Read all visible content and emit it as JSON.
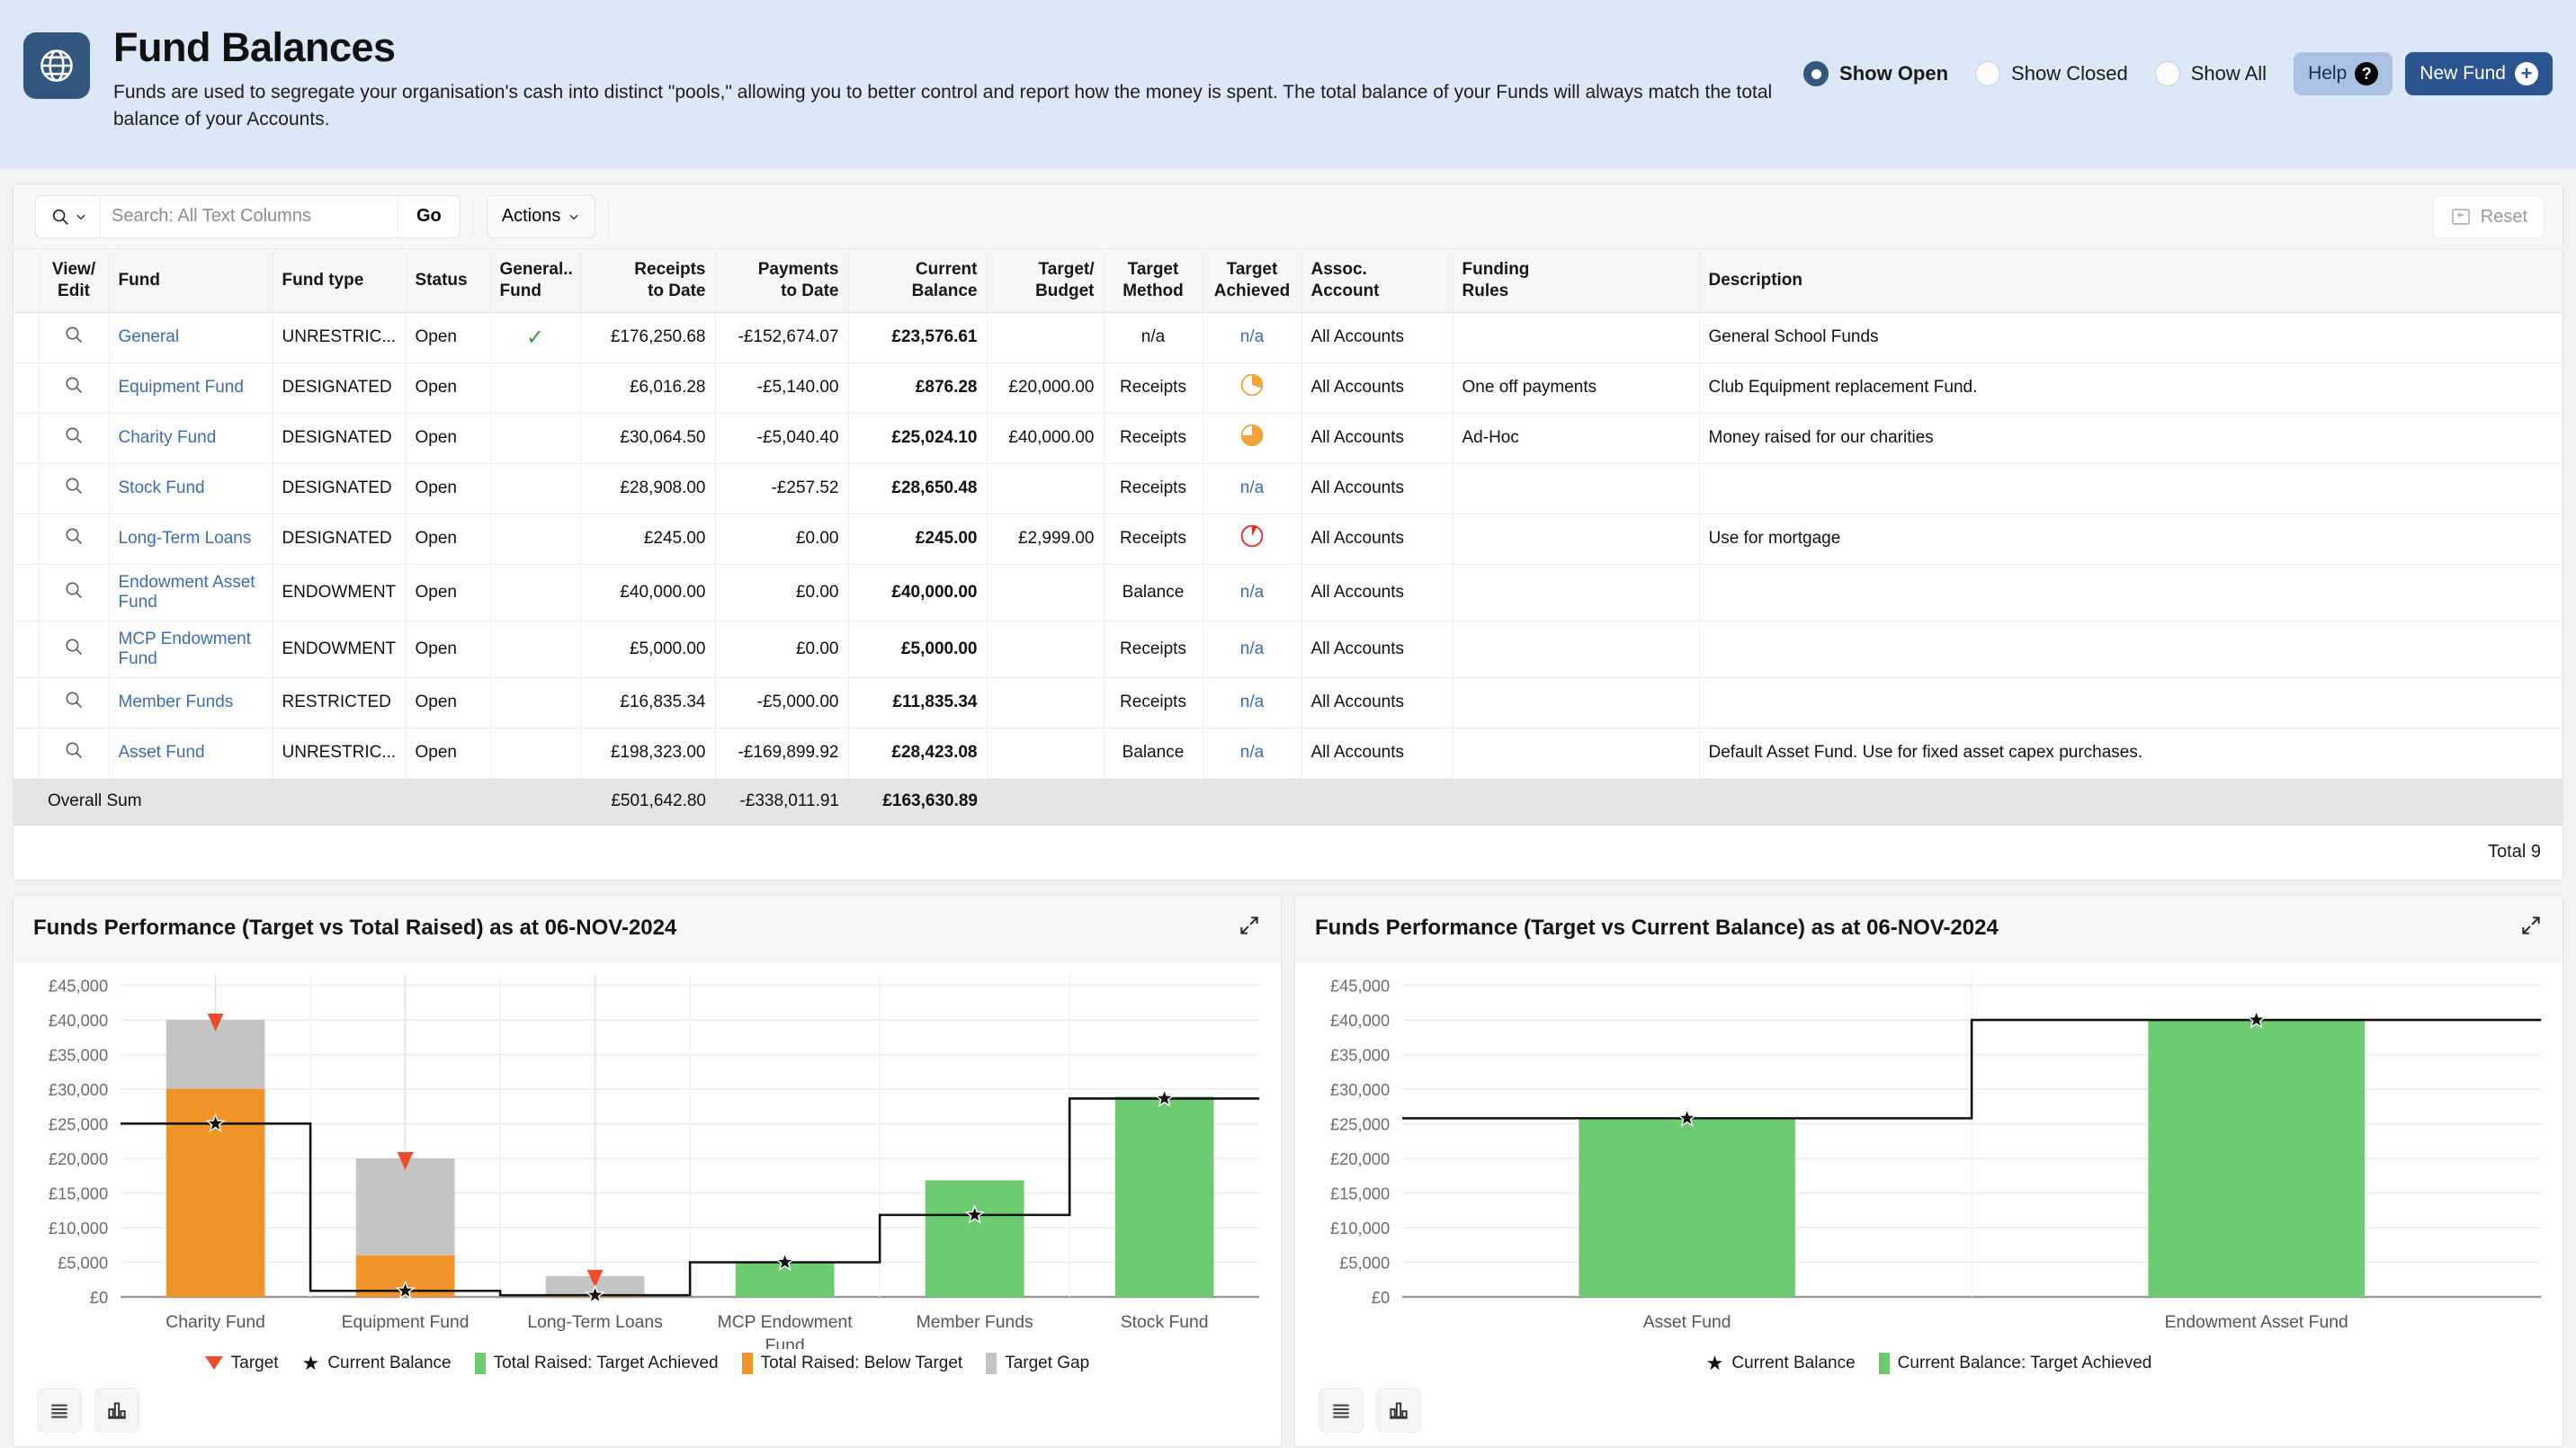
{
  "header": {
    "title": "Fund Balances",
    "description": "Funds are used to segregate your organisation's cash into distinct \"pools,\" allowing you to better control and report how the money is spent. The total balance of your Funds will always match the total balance of your Accounts.",
    "app_icon": "globe-icon",
    "radios": [
      {
        "label": "Show Open",
        "selected": true
      },
      {
        "label": "Show Closed",
        "selected": false
      },
      {
        "label": "Show All",
        "selected": false
      }
    ],
    "help_label": "Help",
    "new_fund_label": "New Fund",
    "accent_color": "#2a5591",
    "header_bg": "#dce7f7"
  },
  "toolbar": {
    "search_placeholder": "Search: All Text Columns",
    "search_value": "",
    "go_label": "Go",
    "actions_label": "Actions",
    "reset_label": "Reset"
  },
  "table": {
    "columns": [
      "View/ Edit",
      "Fund",
      "Fund type",
      "Status",
      "General.. Fund",
      "Receipts to Date",
      "Payments to Date",
      "Current Balance",
      "Target/ Budget",
      "Target Method",
      "Target Achieved",
      "Assoc. Account",
      "Funding Rules",
      "Description"
    ],
    "columns_split": [
      [
        "View/",
        "Edit"
      ],
      [
        "Fund",
        ""
      ],
      [
        "Fund type",
        ""
      ],
      [
        "Status",
        ""
      ],
      [
        "General..",
        "Fund"
      ],
      [
        "Receipts",
        "to Date"
      ],
      [
        "Payments",
        "to Date"
      ],
      [
        "Current",
        "Balance"
      ],
      [
        "Target/",
        "Budget"
      ],
      [
        "Target",
        "Method"
      ],
      [
        "Target",
        "Achieved"
      ],
      [
        "Assoc.",
        "Account"
      ],
      [
        "Funding",
        "Rules"
      ],
      [
        "Description",
        ""
      ]
    ],
    "rows": [
      {
        "fund": "General",
        "fund_type": "UNRESTRIC...",
        "status": "Open",
        "general_fund": true,
        "receipts": "£176,250.68",
        "payments": "-£152,674.07",
        "balance": "£23,576.61",
        "target": "",
        "method": "n/a",
        "achieved": "n/a",
        "achieved_type": "na",
        "account": "All Accounts",
        "rules": "",
        "description": "General School Funds"
      },
      {
        "fund": "Equipment Fund",
        "fund_type": "DESIGNATED",
        "status": "Open",
        "general_fund": false,
        "receipts": "£6,016.28",
        "payments": "-£5,140.00",
        "balance": "£876.28",
        "target": "£20,000.00",
        "method": "Receipts",
        "achieved": "",
        "achieved_type": "pie-orange-30",
        "account": "All Accounts",
        "rules": "One off payments",
        "description": "Club Equipment replacement Fund."
      },
      {
        "fund": "Charity Fund",
        "fund_type": "DESIGNATED",
        "status": "Open",
        "general_fund": false,
        "receipts": "£30,064.50",
        "payments": "-£5,040.40",
        "balance": "£25,024.10",
        "target": "£40,000.00",
        "method": "Receipts",
        "achieved": "",
        "achieved_type": "pie-orange-75",
        "account": "All Accounts",
        "rules": "Ad-Hoc",
        "description": "Money raised for our charities"
      },
      {
        "fund": "Stock Fund",
        "fund_type": "DESIGNATED",
        "status": "Open",
        "general_fund": false,
        "receipts": "£28,908.00",
        "payments": "-£257.52",
        "balance": "£28,650.48",
        "target": "",
        "method": "Receipts",
        "achieved": "n/a",
        "achieved_type": "na",
        "account": "All Accounts",
        "rules": "",
        "description": ""
      },
      {
        "fund": "Long-Term Loans",
        "fund_type": "DESIGNATED",
        "status": "Open",
        "general_fund": false,
        "receipts": "£245.00",
        "payments": "£0.00",
        "balance": "£245.00",
        "target": "£2,999.00",
        "method": "Receipts",
        "achieved": "",
        "achieved_type": "pie-red-8",
        "account": "All Accounts",
        "rules": "",
        "description": "Use for mortgage"
      },
      {
        "fund": "Endowment Asset Fund",
        "fund_type": "ENDOWMENT",
        "status": "Open",
        "general_fund": false,
        "receipts": "£40,000.00",
        "payments": "£0.00",
        "balance": "£40,000.00",
        "target": "",
        "method": "Balance",
        "achieved": "n/a",
        "achieved_type": "na",
        "account": "All Accounts",
        "rules": "",
        "description": ""
      },
      {
        "fund": "MCP Endowment Fund",
        "fund_type": "ENDOWMENT",
        "status": "Open",
        "general_fund": false,
        "receipts": "£5,000.00",
        "payments": "£0.00",
        "balance": "£5,000.00",
        "target": "",
        "method": "Receipts",
        "achieved": "n/a",
        "achieved_type": "na",
        "account": "All Accounts",
        "rules": "",
        "description": ""
      },
      {
        "fund": "Member Funds",
        "fund_type": "RESTRICTED",
        "status": "Open",
        "general_fund": false,
        "receipts": "£16,835.34",
        "payments": "-£5,000.00",
        "balance": "£11,835.34",
        "target": "",
        "method": "Receipts",
        "achieved": "n/a",
        "achieved_type": "na",
        "account": "All Accounts",
        "rules": "",
        "description": ""
      },
      {
        "fund": "Asset Fund",
        "fund_type": "UNRESTRIC...",
        "status": "Open",
        "general_fund": false,
        "receipts": "£198,323.00",
        "payments": "-£169,899.92",
        "balance": "£28,423.08",
        "target": "",
        "method": "Balance",
        "achieved": "n/a",
        "achieved_type": "na",
        "account": "All Accounts",
        "rules": "",
        "description": "Default Asset Fund. Use for fixed asset capex purchases."
      }
    ],
    "summary": {
      "label": "Overall Sum",
      "receipts": "£501,642.80",
      "payments": "-£338,011.91",
      "balance": "£163,630.89"
    },
    "total_label": "Total 9"
  },
  "chart_data": [
    {
      "type": "bar",
      "panel": "left",
      "title": "Funds Performance (Target vs Total Raised) as at 06-NOV-2024",
      "xlabel": "",
      "ylabel": "",
      "ylim": [
        0,
        46500
      ],
      "yticks": [
        "£0",
        "£5,000",
        "£10,000",
        "£15,000",
        "£20,000",
        "£25,000",
        "£30,000",
        "£35,000",
        "£40,000",
        "£45,000"
      ],
      "ytick_values": [
        0,
        5000,
        10000,
        15000,
        20000,
        25000,
        30000,
        35000,
        40000,
        45000
      ],
      "grid": true,
      "legend_position": "bottom",
      "categories": [
        "Charity Fund",
        "Equipment Fund",
        "Long-Term Loans",
        "MCP Endowment Fund",
        "Member Funds",
        "Stock Fund"
      ],
      "series": [
        {
          "name": "Total Raised: Target Achieved",
          "color": "#6dcc72",
          "values": [
            0,
            0,
            0,
            5000,
            16835,
            28908
          ]
        },
        {
          "name": "Total Raised: Below Target",
          "color": "#f0932b",
          "values": [
            30064,
            6016,
            245,
            0,
            0,
            0
          ]
        },
        {
          "name": "Target Gap",
          "color": "#c4c4c4",
          "values": [
            9936,
            13984,
            2754,
            0,
            0,
            0
          ]
        },
        {
          "name": "Target",
          "color": "#ef4d2a",
          "marker": "triangle-down",
          "values": [
            40000,
            20000,
            2999,
            null,
            null,
            null
          ]
        },
        {
          "name": "Current Balance",
          "color": "#111111",
          "marker": "star",
          "values": [
            25024,
            876,
            245,
            5000,
            11835,
            28650
          ]
        }
      ],
      "legend": [
        {
          "label": "Target",
          "color": "#ef4d2a",
          "marker": "triangle-down"
        },
        {
          "label": "Current Balance",
          "color": "#111111",
          "marker": "star"
        },
        {
          "label": "Total Raised: Target Achieved",
          "color": "#6dcc72",
          "marker": "square"
        },
        {
          "label": "Total Raised: Below Target",
          "color": "#f0932b",
          "marker": "square"
        },
        {
          "label": "Target Gap",
          "color": "#c4c4c4",
          "marker": "square"
        }
      ]
    },
    {
      "type": "bar",
      "panel": "right",
      "title": "Funds Performance (Target vs Current Balance) as at 06-NOV-2024",
      "xlabel": "",
      "ylabel": "",
      "ylim": [
        0,
        46500
      ],
      "yticks": [
        "£0",
        "£5,000",
        "£10,000",
        "£15,000",
        "£20,000",
        "£25,000",
        "£30,000",
        "£35,000",
        "£40,000",
        "£45,000"
      ],
      "ytick_values": [
        0,
        5000,
        10000,
        15000,
        20000,
        25000,
        30000,
        35000,
        40000,
        45000
      ],
      "grid": true,
      "legend_position": "bottom",
      "categories": [
        "Asset Fund",
        "Endowment Asset Fund"
      ],
      "series": [
        {
          "name": "Current Balance: Target Achieved",
          "color": "#6dcc72",
          "values": [
            25800,
            40000
          ]
        },
        {
          "name": "Current Balance",
          "color": "#111111",
          "marker": "star",
          "values": [
            25800,
            40000
          ]
        }
      ],
      "legend": [
        {
          "label": "Current Balance",
          "color": "#111111",
          "marker": "star"
        },
        {
          "label": "Current Balance: Target Achieved",
          "color": "#6dcc72",
          "marker": "square"
        }
      ]
    }
  ],
  "chart_controls": {
    "list_view_icon": "list-view-icon",
    "chart_view_icon": "bar-chart-icon",
    "expand_icon": "expand-icon"
  }
}
